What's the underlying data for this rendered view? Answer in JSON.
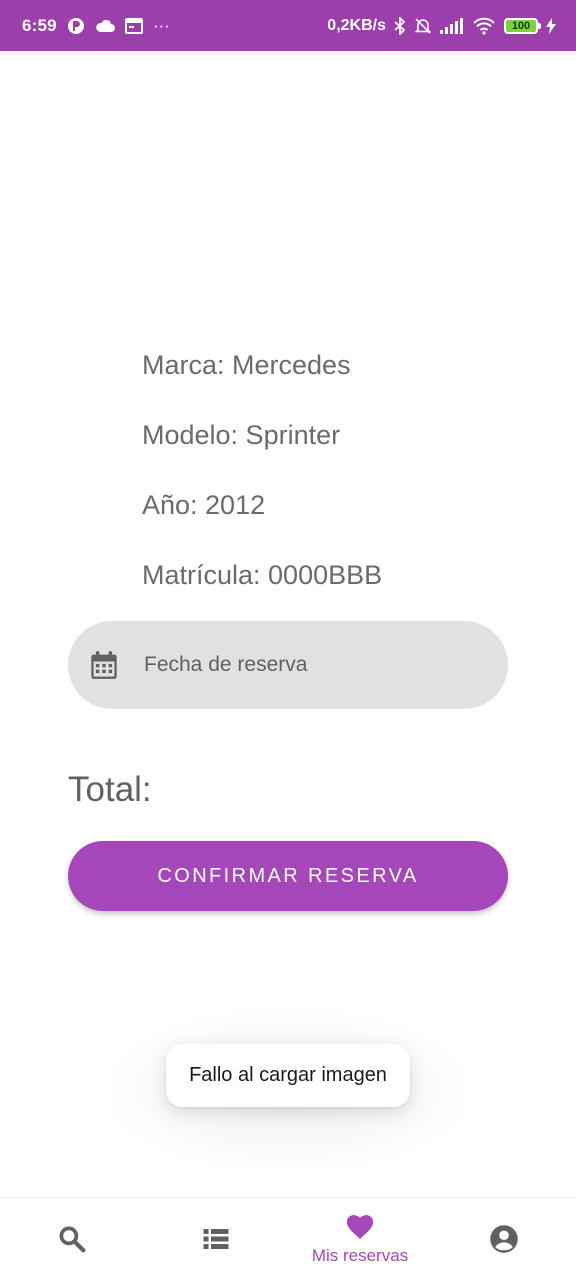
{
  "status_bar": {
    "time": "6:59",
    "more": "···",
    "speed": "0,2KB/s",
    "battery": "100",
    "bg_color": "#9c3fad"
  },
  "vehicle": {
    "brand": "Marca: Mercedes",
    "model": "Modelo: Sprinter",
    "year": "Año: 2012",
    "plate": "Matrícula: 0000BBB"
  },
  "date_field": {
    "label": "Fecha de reserva",
    "icon": "calendar-icon"
  },
  "total": {
    "label": "Total:"
  },
  "confirm_button": {
    "label": "CONFIRMAR RESERVA",
    "color": "#a546bb"
  },
  "toast": {
    "message": "Fallo al cargar imagen"
  },
  "bottom_nav": {
    "items": [
      {
        "icon": "search-icon",
        "label": ""
      },
      {
        "icon": "list-icon",
        "label": ""
      },
      {
        "icon": "heart-icon",
        "label": "Mis reservas",
        "active": true
      },
      {
        "icon": "account-icon",
        "label": ""
      }
    ],
    "active_color": "#a546bb",
    "inactive_color": "#616161"
  }
}
